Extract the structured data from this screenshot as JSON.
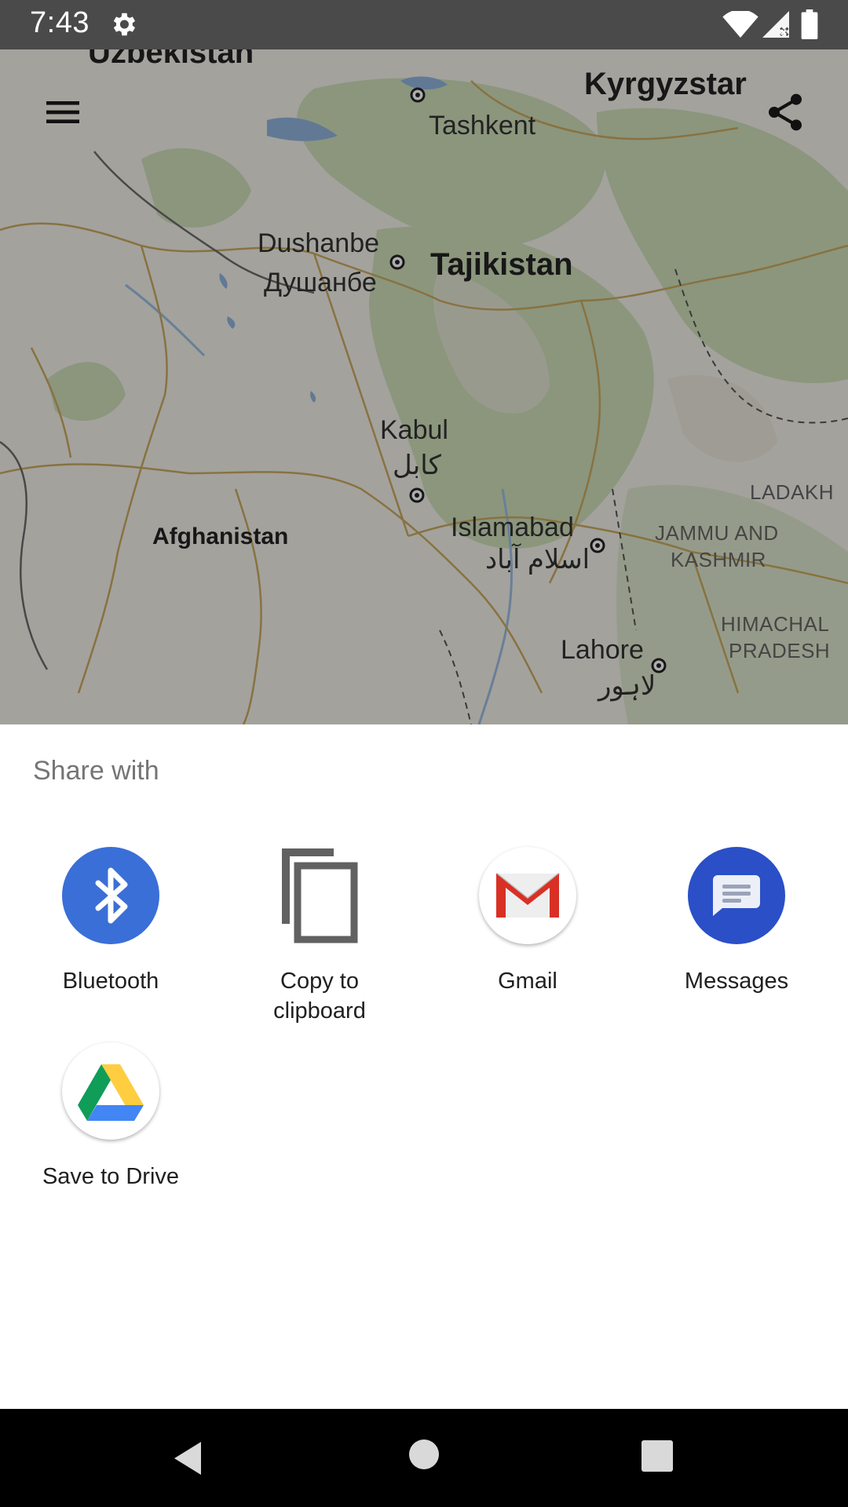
{
  "status_bar": {
    "time": "7:43",
    "icons": [
      "settings-icon",
      "wifi-icon",
      "cell-signal-icon",
      "battery-icon"
    ]
  },
  "map": {
    "labels": {
      "uzbekistan": "Uzbekistan",
      "kyrgyzstan": "Kyrgyzstar",
      "tashkent": "Tashkent",
      "dushanbe": "Dushanbe",
      "dushanbe_cyr": "Душанбе",
      "tajikistan": "Tajikistan",
      "kabul": "Kabul",
      "kabul_local": "کابل",
      "afghanistan": "Afghanistan",
      "islamabad": "Islamabad",
      "islamabad_local": "اسلام آباد",
      "ladakh": "LADAKH",
      "jammu_kashmir_1": "JAMMU AND",
      "jammu_kashmir_2": "KASHMIR",
      "himachal_1": "HIMACHAL",
      "himachal_2": "PRADESH",
      "lahore": "Lahore",
      "lahore_local": "لاہور"
    },
    "buttons": [
      "menu-icon",
      "share-icon"
    ]
  },
  "share_sheet": {
    "title": "Share with",
    "targets": [
      {
        "label": "Bluetooth",
        "icon": "bluetooth-icon",
        "color": "#3a6fd8"
      },
      {
        "label_line1": "Copy to",
        "label_line2": "clipboard",
        "icon": "copy-icon",
        "color": "#616161"
      },
      {
        "label": "Gmail",
        "icon": "gmail-icon",
        "color": "#d93025"
      },
      {
        "label": "Messages",
        "icon": "messages-icon",
        "color": "#2a4fc7"
      },
      {
        "label": "Save to Drive",
        "icon": "drive-icon",
        "colors": [
          "#0f9d58",
          "#ffcd40",
          "#4285f4"
        ]
      }
    ]
  },
  "nav_bar": {
    "buttons": [
      "back-icon",
      "home-icon",
      "recents-icon"
    ]
  }
}
